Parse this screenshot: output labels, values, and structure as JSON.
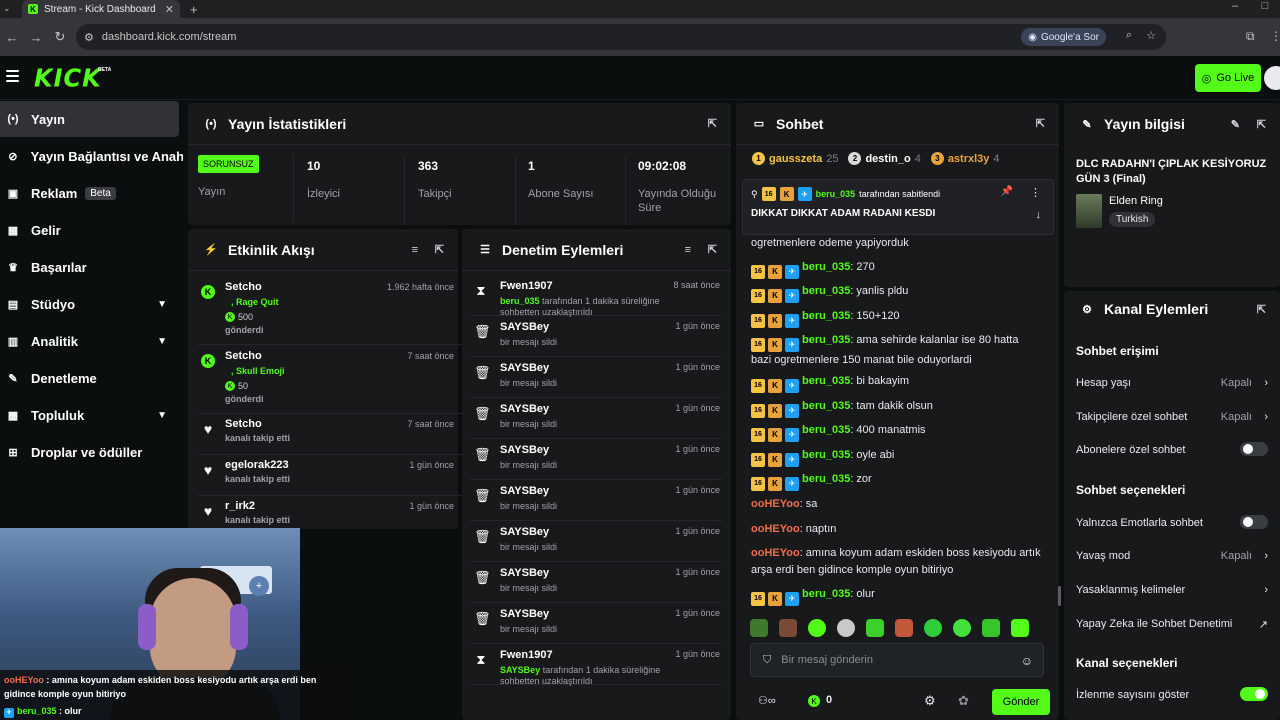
{
  "browser": {
    "tab_title": "Stream - Kick Dashboard",
    "new_tab": "+",
    "url": "dashboard.kick.com/stream",
    "ask_google": "Google'a Sor"
  },
  "header": {
    "logo": "KICK",
    "logo_badge": "BETA",
    "go_live": "Go Live"
  },
  "sidebar": {
    "items": [
      {
        "label": "Yayın",
        "icon": "broadcast-icon"
      },
      {
        "label": "Yayın Bağlantısı ve Anahtarı",
        "icon": "link-icon"
      },
      {
        "label": "Reklam",
        "icon": "ad-icon",
        "badge": "Beta"
      },
      {
        "label": "Gelir",
        "icon": "revenue-icon"
      },
      {
        "label": "Başarılar",
        "icon": "trophy-icon"
      },
      {
        "label": "Stüdyo",
        "icon": "studio-icon"
      },
      {
        "label": "Analitik",
        "icon": "analytics-icon"
      },
      {
        "label": "Denetleme",
        "icon": "wrench-icon"
      },
      {
        "label": "Topluluk",
        "icon": "community-icon"
      },
      {
        "label": "Droplar ve ödüller",
        "icon": "gift-icon"
      }
    ]
  },
  "stats": {
    "title": "Yayın İstatistikleri",
    "status_badge": "SORUNSUZ",
    "status_label": "Yayın",
    "viewers": {
      "value": "10",
      "label": "İzleyici"
    },
    "followers": {
      "value": "363",
      "label": "Takipçi"
    },
    "subs": {
      "value": "1",
      "label": "Abone Sayısı"
    },
    "uptime": {
      "value": "09:02:08",
      "label": "Yayında Olduğu Süre"
    }
  },
  "activity": {
    "title": "Etkinlik Akışı",
    "items": [
      {
        "name": "Setcho",
        "time": "1.962 hafta önce",
        "reward": ", Rage Quit",
        "amount": "500",
        "desc": "gönderdi"
      },
      {
        "name": "Setcho",
        "time": "7 saat önce",
        "reward": ", Skull Emoji",
        "amount": "50",
        "desc": "gönderdi"
      },
      {
        "name": "Setcho",
        "time": "7 saat önce",
        "desc": "kanalı takip etti"
      },
      {
        "name": "egelorak223",
        "time": "1 gün önce",
        "desc": "kanalı takip etti"
      },
      {
        "name": "r_irk2",
        "time": "1 gün önce",
        "desc": "kanalı takip etti"
      }
    ]
  },
  "moderation": {
    "title": "Denetim Eylemleri",
    "items": [
      {
        "icon": "hourglass-icon",
        "glyph": "⧗",
        "name": "Fwen1907",
        "time": "8 saat önce",
        "actor": "beru_035",
        "desc": " tarafından 1 dakika süreliğine sohbetten uzaklaştırıldı"
      },
      {
        "icon": "trash-icon",
        "glyph": "🗑",
        "name": "SAYSBey",
        "time": "1 gün önce",
        "actor": "",
        "desc": "bir mesajı sildi"
      },
      {
        "icon": "trash-icon",
        "glyph": "🗑",
        "name": "SAYSBey",
        "time": "1 gün önce",
        "actor": "",
        "desc": "bir mesajı sildi"
      },
      {
        "icon": "trash-icon",
        "glyph": "🗑",
        "name": "SAYSBey",
        "time": "1 gün önce",
        "actor": "",
        "desc": "bir mesajı sildi"
      },
      {
        "icon": "trash-icon",
        "glyph": "🗑",
        "name": "SAYSBey",
        "time": "1 gün önce",
        "actor": "",
        "desc": "bir mesajı sildi"
      },
      {
        "icon": "trash-icon",
        "glyph": "🗑",
        "name": "SAYSBey",
        "time": "1 gün önce",
        "actor": "",
        "desc": "bir mesajı sildi"
      },
      {
        "icon": "trash-icon",
        "glyph": "🗑",
        "name": "SAYSBey",
        "time": "1 gün önce",
        "actor": "",
        "desc": "bir mesajı sildi"
      },
      {
        "icon": "trash-icon",
        "glyph": "🗑",
        "name": "SAYSBey",
        "time": "1 gün önce",
        "actor": "",
        "desc": "bir mesajı sildi"
      },
      {
        "icon": "trash-icon",
        "glyph": "🗑",
        "name": "SAYSBey",
        "time": "1 gün önce",
        "actor": "",
        "desc": "bir mesajı sildi"
      },
      {
        "icon": "hourglass-icon",
        "glyph": "⧗",
        "name": "Fwen1907",
        "time": "1 gün önce",
        "actor": "SAYSBey",
        "desc": " tarafından 1 dakika süreliğine sohbetten uzaklaştırıldı"
      }
    ]
  },
  "chat": {
    "title": "Sohbet",
    "top_gifters": [
      {
        "rank": "1",
        "name": "gausszeta",
        "count": "25",
        "color": "#f6c344",
        "name_color": "#f6c344"
      },
      {
        "rank": "2",
        "name": "destin_o",
        "count": "4",
        "color": "#d9dadb",
        "name_color": "#ffffff"
      },
      {
        "rank": "3",
        "name": "astrxl3y",
        "count": "4",
        "color": "#e8a23b",
        "name_color": "#e8a23b"
      }
    ],
    "pinned": {
      "badge": "16",
      "user": "beru_035",
      "suffix": " tarafından sabitlendi",
      "message": "DIKKAT DIKKAT ADAM RADANI KESDI"
    },
    "messages": [
      {
        "user": "",
        "badges": false,
        "text": "ogretmenlere odeme yapiyorduk"
      },
      {
        "user": "beru_035",
        "badges": true,
        "text": ": 270"
      },
      {
        "user": "beru_035",
        "badges": true,
        "text": ": yanlis pldu"
      },
      {
        "user": "beru_035",
        "badges": true,
        "text": ": 150+120"
      },
      {
        "user": "beru_035",
        "badges": true,
        "text": ": ama sehirde kalanlar ise 80 hatta bazi ogretmenlere 150 manat bile oduyorlardi"
      },
      {
        "user": "beru_035",
        "badges": true,
        "text": ": bi bakayim"
      },
      {
        "user": "beru_035",
        "badges": true,
        "text": ": tam dakik olsun"
      },
      {
        "user": "beru_035",
        "badges": true,
        "text": ": 400 manatmis"
      },
      {
        "user": "beru_035",
        "badges": true,
        "text": ": oyle abi"
      },
      {
        "user": "beru_035",
        "badges": true,
        "text": ": zor"
      },
      {
        "user": "ooHEYoo",
        "badges": false,
        "text": ": sa"
      },
      {
        "user": "ooHEYoo",
        "badges": false,
        "text": ": naptın"
      },
      {
        "user": "ooHEYoo",
        "badges": false,
        "text": ": amına koyum adam eskiden boss kesiyodu artık arşa erdi ben gidince komple oyun bitiriyo"
      },
      {
        "user": "beru_035",
        "badges": true,
        "text": ": olur"
      }
    ],
    "badge_sub": "16",
    "input_placeholder": "Bir mesaj gönderin",
    "points": "0",
    "send": "Gönder"
  },
  "stream_info": {
    "title": "Yayın bilgisi",
    "stream_title": "DLC RADAHN'I ÇIPLAK KESİYORUZ GÜN 3 (Final)",
    "game": "Elden Ring",
    "language": "Turkish"
  },
  "channel_actions": {
    "title": "Kanal Eylemleri",
    "chat_access": "Sohbet erişimi",
    "account_age": {
      "label": "Hesap yaşı",
      "value": "Kapalı"
    },
    "followers_only": {
      "label": "Takipçilere özel sohbet",
      "value": "Kapalı"
    },
    "subs_only": {
      "label": "Abonelere özel sohbet"
    },
    "chat_options": "Sohbet seçenekleri",
    "emote_only": {
      "label": "Yalnızca Emotlarla sohbet"
    },
    "slow_mode": {
      "label": "Yavaş mod",
      "value": "Kapalı"
    },
    "banned_words": {
      "label": "Yasaklanmış kelimeler"
    },
    "ai_moderation": {
      "label": "Yapay Zeka ile Sohbet Denetimi"
    },
    "channel_options": "Kanal seçenekleri",
    "show_viewers": {
      "label": "İzlenme sayısını göster"
    }
  },
  "overlay_chat": [
    {
      "user": "ooHEYoo",
      "text": " : amına koyum adam eskiden boss kesiyodu artık arşa erdi ben gidince komple oyun bitiriyo"
    },
    {
      "user": "beru_035",
      "text": " : olur"
    }
  ],
  "colors": {
    "brand": "#53fc18",
    "panel": "#17191b",
    "bg": "#0b0e0f"
  }
}
